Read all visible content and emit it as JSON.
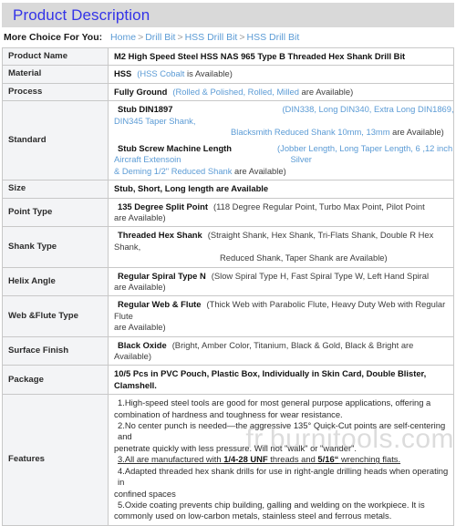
{
  "header": {
    "title": "Product Description"
  },
  "breadcrumb": {
    "label": "More Choice For You:",
    "separator": ">",
    "items": [
      {
        "label": "Home"
      },
      {
        "label": "Drill Bit"
      },
      {
        "label": "HSS Drill Bit"
      },
      {
        "label": "HSS Drill Bit"
      }
    ]
  },
  "table": {
    "rows": {
      "product_name": {
        "key": "Product Name",
        "value": "M2 High Speed Steel HSS NAS 965 Type B Threaded Hex Shank Drill Bit"
      },
      "material": {
        "key": "Material",
        "main": "HSS",
        "paren_open": "(",
        "alt": "HSS Cobalt",
        "tail": " is Available)"
      },
      "process": {
        "key": "Process",
        "main": "Fully Ground",
        "paren_open": "(",
        "alt": "Rolled & Polished, Rolled, Milled",
        "tail": " are Available)"
      },
      "standard": {
        "key": "Standard",
        "line1_main": "Stub DIN1897",
        "line1_alt": "(DIN338, Long DIN340, Extra Long DIN1869,",
        "line2_alt": "DIN345 Taper Shank,",
        "line3_alt": "Blacksmith Reduced Shank 10mm, 13mm",
        "line3_tail": " are Available)",
        "line4_main": "Stub Screw Machine Length",
        "line4_alt": "(Jobber Length, Long Taper Length, 6 ,12 inch",
        "line5_alt_a": "Aircraft Extensoin",
        "line5_alt_b": "Silver",
        "line6_alt": "& Deming 1/2\" Reduced Shank",
        "line6_tail": " are Available)"
      },
      "size": {
        "key": "Size",
        "value": "Stub, Short, Long length are Available"
      },
      "point_type": {
        "key": "Point Type",
        "main": "135 Degree Split Point",
        "alt_line1": "(118 Degree Regular Point, Turbo Max Point, Pilot Point",
        "alt_line2": "are Available)"
      },
      "shank_type": {
        "key": "Shank Type",
        "main": "Threaded Hex Shank",
        "alt_line1": "(Straight Shank, Hex Shank, Tri-Flats Shank, Double R Hex Shank,",
        "alt_line2": "Reduced Shank, Taper Shank are Available)"
      },
      "helix_angle": {
        "key": "Helix Angle",
        "main": "Regular Spiral Type N",
        "alt_line1": "(Slow Spiral Type H, Fast Spiral Type W, Left Hand Spiral",
        "alt_line2": "are Available)"
      },
      "web_flute": {
        "key": "Web &Flute Type",
        "main": "Regular Web & Flute",
        "alt_line1": "(Thick Web with Parabolic Flute, Heavy Duty Web with Regular Flute",
        "alt_line2": "are Available)"
      },
      "surface_finish": {
        "key": "Surface Finish",
        "main": "Black Oxide",
        "alt": "(Bright, Amber Color, Titanium, Black & Gold, Black & Bright are Available)"
      },
      "package": {
        "key": "Package",
        "value": "10/5 Pcs in PVC Pouch, Plastic Box, Individually in Skin Card, Double Blister, Clamshell."
      },
      "features": {
        "key": "Features",
        "items": {
          "f1_line1": "1.High-speed steel tools are good for most general purpose applications, offering a",
          "f1_line2": "combination of hardness   and toughness for wear resistance.",
          "f2_line1": "2.No center punch is needed—the aggressive 135° Quick-Cut points are self-centering and",
          "f2_line2": "penetrate quickly   with less pressure. Will not \"walk\" or \"wander\".",
          "f3_a": "3.All are manufactured with ",
          "f3_b": "1/4-28 UNF",
          "f3_c": " threads and ",
          "f3_d": "5/16“",
          "f3_e": " wrenching flats.",
          "f4_line1": "4.Adapted threaded hex shank drills for use in right-angle drilling heads when operating in",
          "f4_line2": "confined   spaces",
          "f5_line1": "5.Oxide coating prevents chip building, galling and welding on the workpiece. It is",
          "f5_line2": "commonly used on low-carbon metals, stainless steel and ferrous metals."
        }
      }
    }
  },
  "watermark": {
    "text": "fr.burnitools.com"
  },
  "colors": {
    "title_text": "#3434e8",
    "title_bg": "#d9d9d9",
    "link_blue": "#5b9bd5",
    "key_bg": "#f3f4f6",
    "border": "#c8c8c8"
  }
}
